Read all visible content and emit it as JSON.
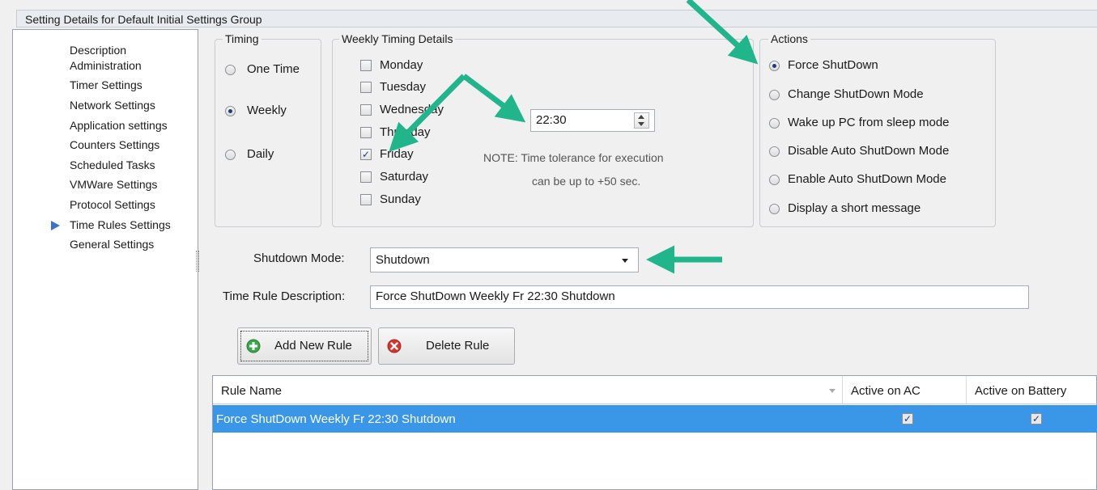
{
  "title": "Setting Details for Default Initial Settings Group",
  "nav": {
    "items": [
      {
        "label": "Description"
      },
      {
        "label": "Administration"
      },
      {
        "label": "Timer Settings"
      },
      {
        "label": "Network Settings"
      },
      {
        "label": "Application settings"
      },
      {
        "label": "Counters Settings"
      },
      {
        "label": "Scheduled Tasks"
      },
      {
        "label": "VMWare Settings"
      },
      {
        "label": "Protocol Settings"
      },
      {
        "label": "Time Rules Settings",
        "selected": true
      },
      {
        "label": "General Settings"
      }
    ]
  },
  "timing": {
    "title": "Timing",
    "options": [
      {
        "label": "One Time",
        "checked": false
      },
      {
        "label": "Weekly",
        "checked": true
      },
      {
        "label": "Daily",
        "checked": false
      }
    ]
  },
  "weekly": {
    "title": "Weekly Timing Details",
    "days": [
      {
        "label": "Monday",
        "checked": false
      },
      {
        "label": "Tuesday",
        "checked": false
      },
      {
        "label": "Wednesday",
        "checked": false
      },
      {
        "label": "Thursday",
        "checked": false
      },
      {
        "label": "Friday",
        "checked": true
      },
      {
        "label": "Saturday",
        "checked": false
      },
      {
        "label": "Sunday",
        "checked": false
      }
    ],
    "time": "22:30",
    "note_line1": "NOTE: Time tolerance  for execution",
    "note_line2": "can be up to +50 sec."
  },
  "actions": {
    "title": "Actions",
    "options": [
      {
        "label": "Force ShutDown",
        "checked": true
      },
      {
        "label": "Change ShutDown Mode",
        "checked": false
      },
      {
        "label": "Wake up PC from sleep mode",
        "checked": false
      },
      {
        "label": "Disable Auto ShutDown Mode",
        "checked": false
      },
      {
        "label": "Enable Auto ShutDown Mode",
        "checked": false
      },
      {
        "label": "Display a short message",
        "checked": false
      }
    ]
  },
  "shutdown_mode": {
    "label": "Shutdown Mode:",
    "value": "Shutdown"
  },
  "description": {
    "label": "Time Rule Description:",
    "value": "Force ShutDown Weekly Fr  22:30  Shutdown"
  },
  "buttons": {
    "add": "Add New Rule",
    "delete": "Delete Rule"
  },
  "table": {
    "columns": [
      "Rule Name",
      "Active on AC",
      "Active on Battery"
    ],
    "rows": [
      {
        "name": "Force ShutDown Weekly Fr  22:30  Shutdown",
        "ac": true,
        "battery": true
      }
    ]
  },
  "colors": {
    "arrow": "#20b58a",
    "selection": "#3a96e6",
    "nav_arrow": "#3a73c8"
  }
}
